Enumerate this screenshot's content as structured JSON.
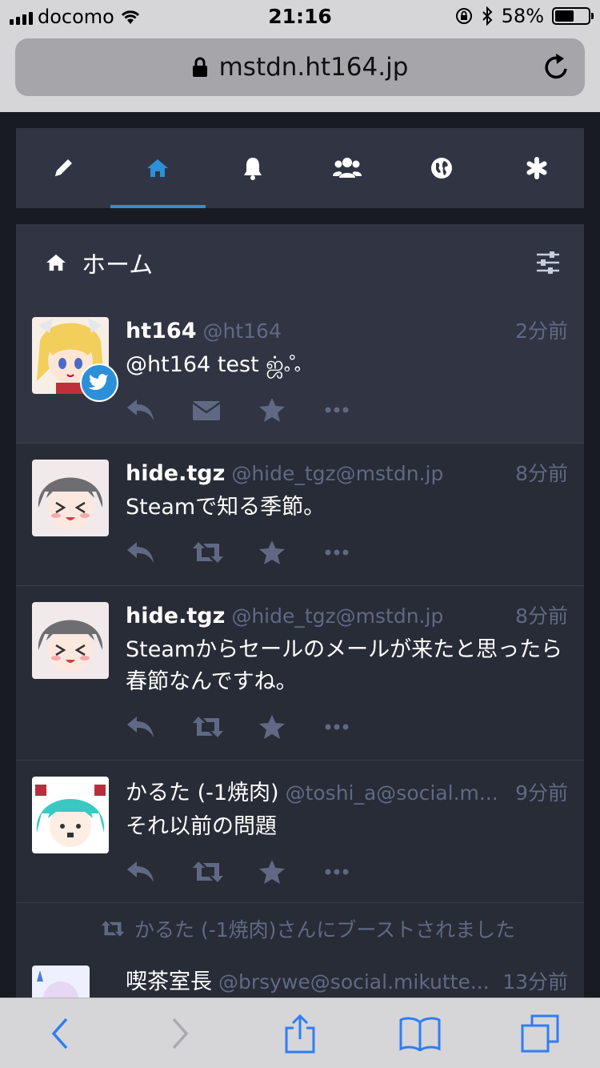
{
  "statusbar": {
    "carrier": "docomo",
    "time": "21:16",
    "battery": "58%",
    "battery_level": 0.58
  },
  "browser": {
    "url": "mstdn.ht164.jp"
  },
  "tabs": [
    {
      "icon": "pencil-icon"
    },
    {
      "icon": "home-icon",
      "active": true
    },
    {
      "icon": "bell-icon"
    },
    {
      "icon": "users-icon"
    },
    {
      "icon": "globe-icon"
    },
    {
      "icon": "asterisk-icon"
    }
  ],
  "column": {
    "title": "ホーム"
  },
  "statuses": [
    {
      "display_name": "ht164",
      "acct": "@ht164",
      "time": "2分前",
      "content": "@ht164 test ஜ்ஃ",
      "second_action": "envelope-icon"
    },
    {
      "display_name": "hide.tgz",
      "acct": "@hide_tgz@mstdn.jp",
      "time": "8分前",
      "content": "Steamで知る季節。",
      "second_action": "retweet-icon"
    },
    {
      "display_name": "hide.tgz",
      "acct": "@hide_tgz@mstdn.jp",
      "time": "8分前",
      "content": "Steamからセールのメールが来たと思ったら春節なんですね。",
      "second_action": "retweet-icon"
    },
    {
      "display_name": "かるた (-1焼肉)",
      "acct": "@toshi_a@social.m...",
      "time": "9分前",
      "content": "それ以前の問題",
      "second_action": "retweet-icon"
    },
    {
      "boost_note": "かるた (-1焼肉)さんにブーストされました",
      "display_name": "喫茶室長",
      "acct": "@brsywe@social.mikutte...",
      "time": "13分前"
    }
  ],
  "colors": {
    "accent": "#2b90d9",
    "bg": "#191b22",
    "column": "#282c37",
    "muted": "#606984"
  }
}
